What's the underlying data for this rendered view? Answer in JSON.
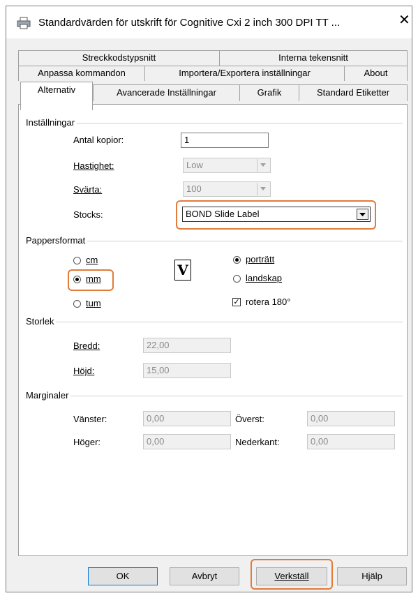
{
  "window": {
    "title": "Standardvärden för utskrift för Cognitive Cxi 2 inch 300 DPI TT ...",
    "close_glyph": "✕"
  },
  "tabs": {
    "row1": [
      "Streckkodstypsnitt",
      "Interna tekensnitt"
    ],
    "row2": [
      "Anpassa kommandon",
      "Importera/Exportera inställningar",
      "About"
    ],
    "row3": [
      "Alternativ",
      "Avancerade Inställningar",
      "Grafik",
      "Standard Etiketter"
    ],
    "active": "Alternativ"
  },
  "installningar": {
    "group_label": "Inställningar",
    "antal_kopior": {
      "label": "Antal kopior:",
      "value": "1"
    },
    "hastighet": {
      "label": "Hastighet:",
      "value": "Low"
    },
    "svarta": {
      "label": "Svärta:",
      "value": "100"
    },
    "stocks": {
      "label": "Stocks:",
      "value": "BOND Slide Label"
    }
  },
  "pappersformat": {
    "group_label": "Pappersformat",
    "units": {
      "cm": "cm",
      "mm": "mm",
      "tum": "tum",
      "selected": "mm"
    },
    "orientation": {
      "portratt": "porträtt",
      "landskap": "landskap",
      "selected": "porträtt"
    },
    "rotate": {
      "label": "rotera 180°",
      "checked": true
    },
    "preview_glyph": "V"
  },
  "storlek": {
    "group_label": "Storlek",
    "bredd": {
      "label": "Bredd:",
      "value": "22,00"
    },
    "hojd": {
      "label": "Höjd:",
      "value": "15,00"
    }
  },
  "marginaler": {
    "group_label": "Marginaler",
    "vanster": {
      "label": "Vänster:",
      "value": "0,00"
    },
    "hoger": {
      "label": "Höger:",
      "value": "0,00"
    },
    "overst": {
      "label": "Överst:",
      "value": "0,00"
    },
    "nederkant": {
      "label": "Nederkant:",
      "value": "0,00"
    }
  },
  "buttons": {
    "ok": "OK",
    "avbryt": "Avbryt",
    "verkstall": "Verkställ",
    "hjalp": "Hjälp"
  },
  "colors": {
    "highlight": "#e07b39",
    "default_button_border": "#0078d7"
  }
}
